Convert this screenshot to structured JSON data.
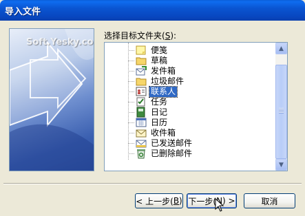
{
  "window": {
    "title": "导入文件"
  },
  "art": {
    "watermark": "Soft.Yesky.com"
  },
  "prompt": {
    "text": "选择目标文件夹(",
    "hotkey": "S",
    "suffix": "):"
  },
  "tree": {
    "selected_index": 4,
    "items": [
      {
        "label": "便笺",
        "icon": "note-icon"
      },
      {
        "label": "草稿",
        "icon": "folder-icon"
      },
      {
        "label": "发件箱",
        "icon": "outbox-icon"
      },
      {
        "label": "垃圾邮件",
        "icon": "folder-icon"
      },
      {
        "label": "联系人",
        "icon": "contacts-icon"
      },
      {
        "label": "任务",
        "icon": "tasks-icon"
      },
      {
        "label": "日记",
        "icon": "journal-icon"
      },
      {
        "label": "日历",
        "icon": "calendar-icon"
      },
      {
        "label": "收件箱",
        "icon": "inbox-icon"
      },
      {
        "label": "已发送邮件",
        "icon": "sent-icon"
      },
      {
        "label": "已删除邮件",
        "icon": "deleted-icon"
      }
    ]
  },
  "buttons": {
    "back": {
      "pre": "< 上一步(",
      "hotkey": "B",
      "post": ")"
    },
    "next": {
      "pre": "下一步(",
      "hotkey": "N",
      "post": ") >"
    },
    "cancel": "取消"
  },
  "colors": {
    "titlebar": "#0a55d1",
    "selection": "#316ac5",
    "dialog": "#ece9d8"
  }
}
